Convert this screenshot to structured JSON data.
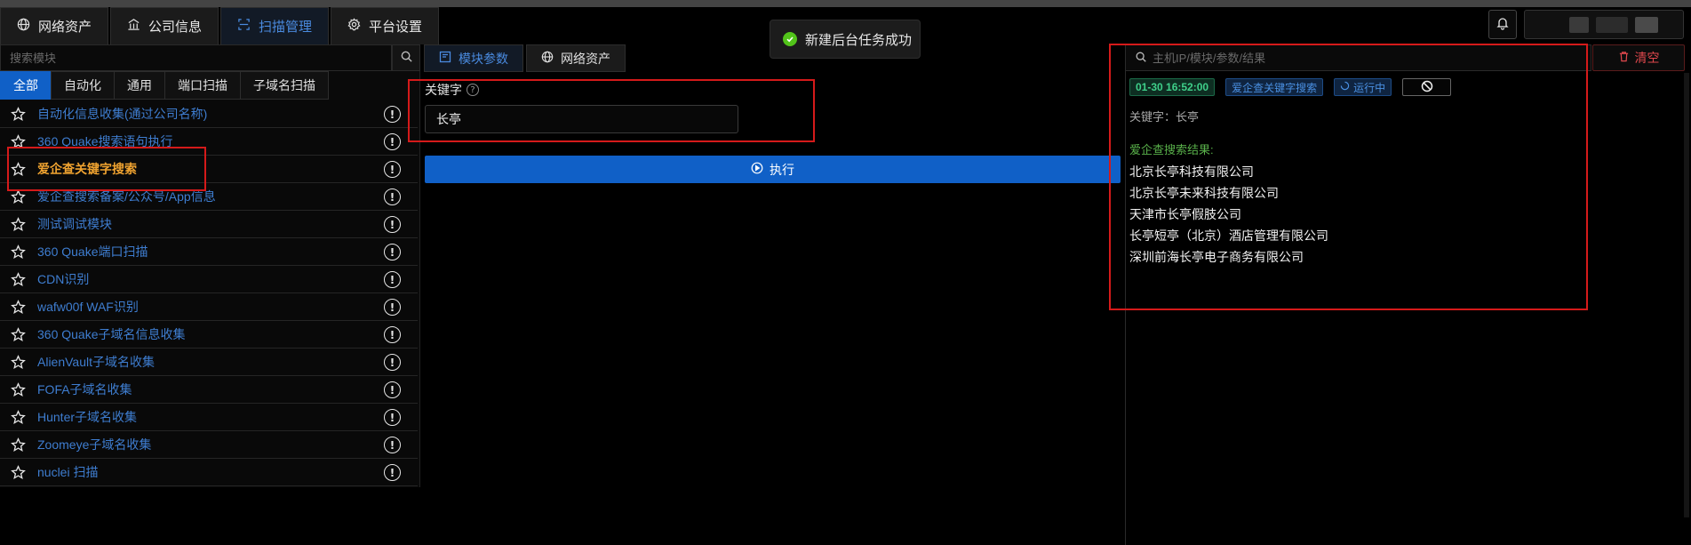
{
  "top_tabs": [
    {
      "label": "网络资产",
      "icon": "globe-icon"
    },
    {
      "label": "公司信息",
      "icon": "building-icon"
    },
    {
      "label": "扫描管理",
      "icon": "scan-icon",
      "active": true
    },
    {
      "label": "平台设置",
      "icon": "gear-icon"
    }
  ],
  "toast": {
    "message": "新建后台任务成功"
  },
  "left": {
    "search_placeholder": "搜索模块",
    "filter_tabs": [
      "全部",
      "自动化",
      "通用",
      "端口扫描",
      "子域名扫描"
    ],
    "modules": [
      "自动化信息收集(通过公司名称)",
      "360 Quake搜索语句执行",
      "爱企查关键字搜索",
      "爱企查搜索备案/公众号/App信息",
      "测试调试模块",
      "360 Quake端口扫描",
      "CDN识别",
      "wafw00f WAF识别",
      "360 Quake子域名信息收集",
      "AlienVault子域名收集",
      "FOFA子域名收集",
      "Hunter子域名收集",
      "Zoomeye子域名收集",
      "nuclei 扫描"
    ]
  },
  "middle": {
    "tabs": [
      {
        "label": "模块参数",
        "active": true
      },
      {
        "label": "网络资产"
      }
    ],
    "keyword_label": "关键字",
    "keyword_value": "长亭",
    "execute_label": "执行"
  },
  "right": {
    "search_placeholder": "主机IP/模块/参数/结果",
    "clear_label": "清空",
    "task": {
      "time": "01-30 16:52:00",
      "module": "爱企查关键字搜索",
      "status": "运行中"
    },
    "keyword_line": "关键字：长亭",
    "result_title": "爱企查搜索结果:",
    "results": [
      "北京长亭科技有限公司",
      "北京长亭未来科技有限公司",
      "天津市长亭假肢公司",
      "长亭短亭（北京）酒店管理有限公司",
      "深圳前海长亭电子商务有限公司"
    ]
  },
  "colors": {
    "accent": "#1060c7",
    "link": "#3e7dd0",
    "selected": "#f0a330",
    "annotation": "#d51a1a",
    "success": "#52c41a"
  }
}
